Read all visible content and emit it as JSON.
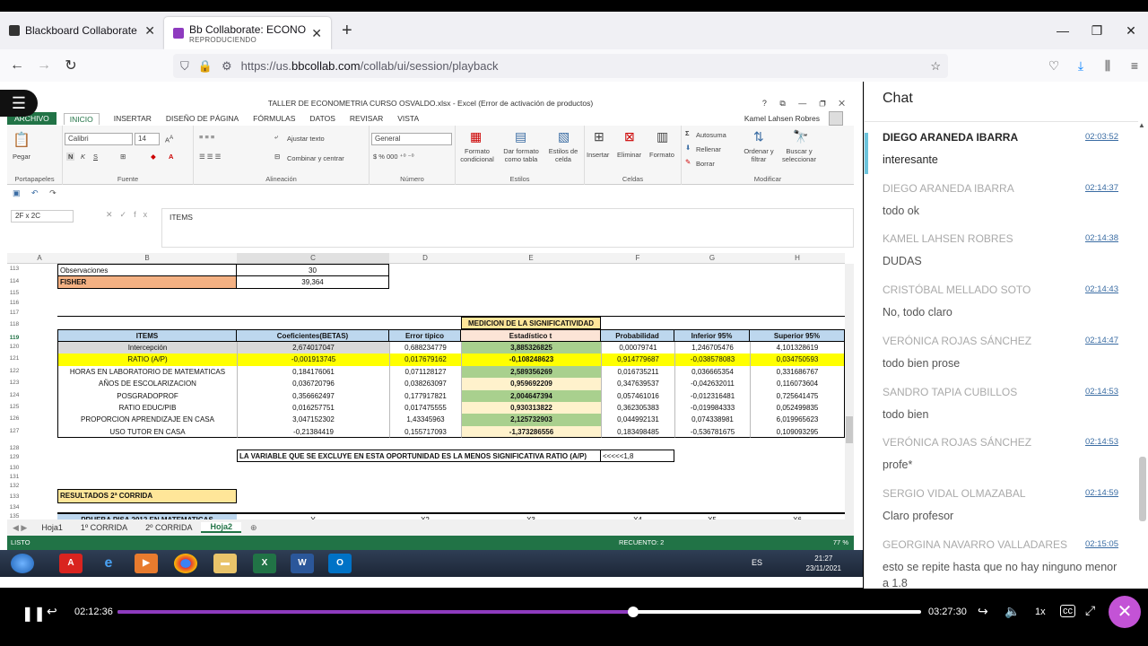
{
  "browser": {
    "tabs": [
      {
        "title": "Blackboard Collaborate Ultra – "
      },
      {
        "title": "Bb Collaborate: ECONOMETRIA",
        "subtitle": "REPRODUCIENDO"
      }
    ],
    "new_tab": "+",
    "url_prefix": "https://us.",
    "url_host": "bbcollab.com",
    "url_path": "/collab/ui/session/playback"
  },
  "excel": {
    "title": "TALLER DE ECONOMETRIA  CURSO OSVALDO.xlsx - Excel (Error de activación de productos)",
    "tabs": [
      "ARCHIVO",
      "INICIO",
      "INSERTAR",
      "DISEÑO DE PÁGINA",
      "FÓRMULAS",
      "DATOS",
      "REVISAR",
      "VISTA"
    ],
    "user": "Kamel Lahsen Robres",
    "font_name": "Calibri",
    "font_size": "14",
    "number_format": "General",
    "ribbon": {
      "portapapeles": "Portapapeles",
      "pegar": "Pegar",
      "fuente": "Fuente",
      "alineacion": "Alineación",
      "numero": "Número",
      "estilos": "Estilos",
      "celdas": "Celdas",
      "modificar": "Modificar",
      "ajustar_texto": "Ajustar texto",
      "combinar": "Combinar y centrar",
      "formato_condicional": "Formato condicional",
      "dar_formato": "Dar formato como tabla",
      "estilos_celda": "Estilos de celda",
      "insertar": "Insertar",
      "eliminar": "Eliminar",
      "formato": "Formato",
      "autosuma": "Autosuma",
      "rellenar": "Rellenar",
      "borrar": "Borrar",
      "ordenar": "Ordenar y filtrar",
      "buscar": "Buscar y seleccionar"
    },
    "name_box": "2F x 2C",
    "formula": "ITEMS",
    "columns": [
      "A",
      "B",
      "C",
      "D",
      "E",
      "F",
      "G",
      "H"
    ],
    "rows": {
      "r113": {
        "num": "113",
        "b": "Observaciones",
        "c": "30"
      },
      "r114": {
        "num": "114",
        "b": "FISHER",
        "c": "39,364"
      },
      "empty": [
        "115",
        "116",
        "117"
      ],
      "r118": {
        "num": "118",
        "e": "MEDICION DE LA SIGNIFICATIVIDAD"
      },
      "r119": {
        "num": "119",
        "b": "ITEMS",
        "c": "Coeficientes(BETAS)",
        "d": "Error típico",
        "e": "Estadístico t",
        "f": "Probabilidad",
        "g": "Inferior 95%",
        "h": "Superior 95%"
      },
      "table": [
        {
          "num": "120",
          "b": "Intercepción",
          "c": "2,674017047",
          "d": "0,688234779",
          "e": "3,885326825",
          "f": "0,00079741",
          "g": "1,246705476",
          "h": "4,101328619"
        },
        {
          "num": "121",
          "b": "RATIO  (A/P)",
          "c": "-0,001913745",
          "d": "0,017679162",
          "e": "-0,108248623",
          "f": "0,914779687",
          "g": "-0,038578083",
          "h": "0,034750593"
        },
        {
          "num": "122",
          "b": "HORAS EN LABORATORIO DE MATEMATICAS",
          "c": "0,184176061",
          "d": "0,071128127",
          "e": "2,589356269",
          "f": "0,016735211",
          "g": "0,036665354",
          "h": "0,331686767"
        },
        {
          "num": "123",
          "b": "AÑOS DE ESCOLARIZACION",
          "c": "0,036720796",
          "d": "0,038263097",
          "e": "0,959692209",
          "f": "0,347639537",
          "g": "-0,042632011",
          "h": "0,116073604"
        },
        {
          "num": "124",
          "b": "POSGRADOPROF",
          "c": "0,356662497",
          "d": "0,177917821",
          "e": "2,004647394",
          "f": "0,057461016",
          "g": "-0,012316481",
          "h": "0,725641475"
        },
        {
          "num": "125",
          "b": "RATIO EDUC/PIB",
          "c": "0,016257751",
          "d": "0,017475555",
          "e": "0,930313822",
          "f": "0,362305383",
          "g": "-0,019984333",
          "h": "0,052499835"
        },
        {
          "num": "126",
          "b": "PROPORCION APRENDIZAJE EN CASA",
          "c": "3,047152302",
          "d": "1,43345963",
          "e": "2,125732903",
          "f": "0,044992131",
          "g": "0,074338981",
          "h": "6,019965623"
        },
        {
          "num": "127",
          "b": "USO TUTOR EN CASA",
          "c": "-0,21384419",
          "d": "0,155717093",
          "e": "-1,373286556",
          "f": "0,183498485",
          "g": "-0,536781675",
          "h": "0,109093295"
        }
      ],
      "r128": {
        "num": "128"
      },
      "r129": {
        "num": "129",
        "note": "LA VARIABLE QUE SE EXCLUYE EN ESTA OPORTUNIDAD  ES LA MENOS SIGNIFICATIVA RATIO (A/P)",
        "f": "<<<<<1,8"
      },
      "empty2": [
        "130",
        "131",
        "132"
      ],
      "r133": {
        "num": "133",
        "b": "RESULTADOS 2ª CORRIDA"
      },
      "r134": {
        "num": "134"
      },
      "r135": {
        "num": "135",
        "b": "PRUEBA PISA 2012 EN MATEMATICAS",
        "c": "Y",
        "d": "X2",
        "e": "X3",
        "f": "X4",
        "g": "X5",
        "h": "X6"
      }
    },
    "sheets": [
      "Hoja1",
      "1º CORRIDA",
      "2º CORRIDA",
      "Hoja2"
    ],
    "active_sheet": "Hoja2",
    "status": "LISTO",
    "status_count": "RECUENTO: 2",
    "zoom": "77 %",
    "taskbar_lang": "ES",
    "taskbar_time": "21:27",
    "taskbar_date": "23/11/2021"
  },
  "chat": {
    "header": "Chat",
    "messages": [
      {
        "name": "DIEGO ARANEDA IBARRA",
        "time": "02:03:52",
        "text": "interesante"
      },
      {
        "name": "DIEGO ARANEDA IBARRA",
        "time": "02:14:37",
        "text": "todo ok"
      },
      {
        "name": "KAMEL LAHSEN ROBRES",
        "time": "02:14:38",
        "text": "DUDAS"
      },
      {
        "name": "CRISTÓBAL MELLADO SOTO",
        "time": "02:14:43",
        "text": "No, todo claro"
      },
      {
        "name": "VERÓNICA ROJAS SÁNCHEZ",
        "time": "02:14:47",
        "text": "todo bien prose"
      },
      {
        "name": "SANDRO TAPIA CUBILLOS",
        "time": "02:14:53",
        "text": "todo bien"
      },
      {
        "name": "VERÓNICA ROJAS SÁNCHEZ",
        "time": "02:14:53",
        "text": "profe*"
      },
      {
        "name": "SERGIO VIDAL OLMAZABAL",
        "time": "02:14:59",
        "text": "Claro profesor"
      },
      {
        "name": "GEORGINA NAVARRO VALLADARES",
        "time": "02:15:05",
        "text": "esto se repite hasta que no hay ninguno menor a 1.8"
      }
    ]
  },
  "player": {
    "current_time": "02:12:36",
    "total_time": "03:27:30",
    "speed": "1x",
    "progress": 0.642,
    "accent": "#8e3bbf"
  }
}
